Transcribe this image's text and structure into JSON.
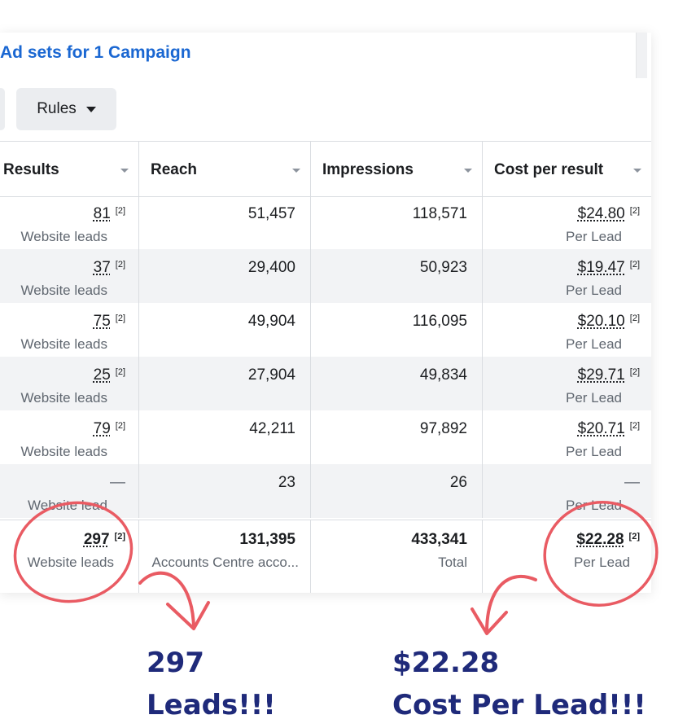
{
  "header": {
    "title": "Ad sets for 1 Campaign",
    "rules_label": "Rules"
  },
  "columns": [
    "Results",
    "Reach",
    "Impressions",
    "Cost per result"
  ],
  "footnote": "[2]",
  "rows": [
    {
      "results": "81",
      "results_sub": "Website leads",
      "reach": "51,457",
      "impressions": "118,571",
      "cost": "$24.80",
      "cost_sub": "Per Lead"
    },
    {
      "results": "37",
      "results_sub": "Website leads",
      "reach": "29,400",
      "impressions": "50,923",
      "cost": "$19.47",
      "cost_sub": "Per Lead"
    },
    {
      "results": "75",
      "results_sub": "Website leads",
      "reach": "49,904",
      "impressions": "116,095",
      "cost": "$20.10",
      "cost_sub": "Per Lead"
    },
    {
      "results": "25",
      "results_sub": "Website leads",
      "reach": "27,904",
      "impressions": "49,834",
      "cost": "$29.71",
      "cost_sub": "Per Lead"
    },
    {
      "results": "79",
      "results_sub": "Website leads",
      "reach": "42,211",
      "impressions": "97,892",
      "cost": "$20.71",
      "cost_sub": "Per Lead"
    },
    {
      "results": "—",
      "results_sub": "Website lead",
      "reach": "23",
      "impressions": "26",
      "cost": "—",
      "cost_sub": "Per Lead"
    }
  ],
  "totals": {
    "results": "297",
    "results_sub": "Website leads",
    "reach": "131,395",
    "reach_sub": "Accounts Centre acco...",
    "impressions": "433,341",
    "impressions_sub": "Total",
    "cost": "$22.28",
    "cost_sub": "Per Lead"
  },
  "annotations": {
    "leads_line1": "297",
    "leads_line2": "Leads!!!",
    "cost_line1": "$22.28",
    "cost_line2": "Cost Per Lead!!!",
    "color": "#e95b63"
  }
}
